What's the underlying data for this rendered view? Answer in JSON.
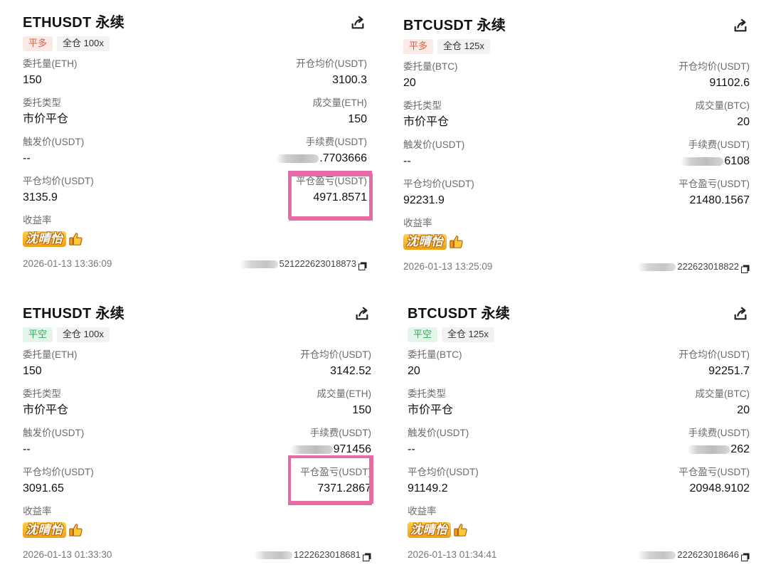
{
  "cards": [
    {
      "title": "ETHUSDT 永续",
      "side_tag": "平多",
      "side": "long",
      "mode_tag": "全仓 100x",
      "qty_label": "委托量(ETH)",
      "qty_value": "150",
      "open_avg_label": "开仓均价(USDT)",
      "open_avg_value": "3100.3",
      "type_label": "委托类型",
      "type_value": "市价平仓",
      "filled_label": "成交量(ETH)",
      "filled_value": "150",
      "trigger_label": "触发价(USDT)",
      "trigger_value": "--",
      "fee_label": "手续费(USDT)",
      "fee_value": ".7703666",
      "close_avg_label": "平仓均价(USDT)",
      "close_avg_value": "3135.9",
      "pnl_label": "平仓盈亏(USDT)",
      "pnl_value": "4971.8571",
      "yield_label": "收益率",
      "sticker": "沈晴怡",
      "time": "2026-01-13 13:36:09",
      "order_id": "521222623018873"
    },
    {
      "title": "BTCUSDT 永续",
      "side_tag": "平多",
      "side": "long",
      "mode_tag": "全仓 125x",
      "qty_label": "委托量(BTC)",
      "qty_value": "20",
      "open_avg_label": "开仓均价(USDT)",
      "open_avg_value": "91102.6",
      "type_label": "委托类型",
      "type_value": "市价平仓",
      "filled_label": "成交量(BTC)",
      "filled_value": "20",
      "trigger_label": "触发价(USDT)",
      "trigger_value": "--",
      "fee_label": "手续费(USDT)",
      "fee_value": "6108",
      "close_avg_label": "平仓均价(USDT)",
      "close_avg_value": "92231.9",
      "pnl_label": "平仓盈亏(USDT)",
      "pnl_value": "21480.1567",
      "yield_label": "收益率",
      "sticker": "沈晴怡",
      "time": "2026-01-13 13:25:09",
      "order_id": "222623018822"
    },
    {
      "title": "ETHUSDT 永续",
      "side_tag": "平空",
      "side": "short",
      "mode_tag": "全仓 100x",
      "qty_label": "委托量(ETH)",
      "qty_value": "150",
      "open_avg_label": "开仓均价(USDT)",
      "open_avg_value": "3142.52",
      "type_label": "委托类型",
      "type_value": "市价平仓",
      "filled_label": "成交量(ETH)",
      "filled_value": "150",
      "trigger_label": "触发价(USDT)",
      "trigger_value": "--",
      "fee_label": "手续费(USDT)",
      "fee_value": "971456",
      "close_avg_label": "平仓均价(USDT)",
      "close_avg_value": "3091.65",
      "pnl_label": "平仓盈亏(USDT)",
      "pnl_value": "7371.2867",
      "yield_label": "收益率",
      "sticker": "沈晴怡",
      "time": "2026-01-13  01:33:30",
      "order_id": "1222623018681"
    },
    {
      "title": "BTCUSDT 永续",
      "side_tag": "平空",
      "side": "short",
      "mode_tag": "全仓 125x",
      "qty_label": "委托量(BTC)",
      "qty_value": "20",
      "open_avg_label": "开仓均价(USDT)",
      "open_avg_value": "92251.7",
      "type_label": "委托类型",
      "type_value": "市价平仓",
      "filled_label": "成交量(BTC)",
      "filled_value": "20",
      "trigger_label": "触发价(USDT)",
      "trigger_value": "--",
      "fee_label": "手续费(USDT)",
      "fee_value": "262",
      "close_avg_label": "平仓均价(USDT)",
      "close_avg_value": "91149.2",
      "pnl_label": "平仓盈亏(USDT)",
      "pnl_value": "20948.9102",
      "yield_label": "收益率",
      "sticker": "沈晴怡",
      "time": "2026-01-13 01:34:41",
      "order_id": "222623018646"
    }
  ],
  "colors": {
    "highlight": "#e86ba6",
    "long": "#d9604a",
    "short": "#2eaa5d"
  },
  "icons": {
    "share": "share-icon",
    "copy": "copy-icon",
    "thumb": "thumbs-up-icon"
  }
}
